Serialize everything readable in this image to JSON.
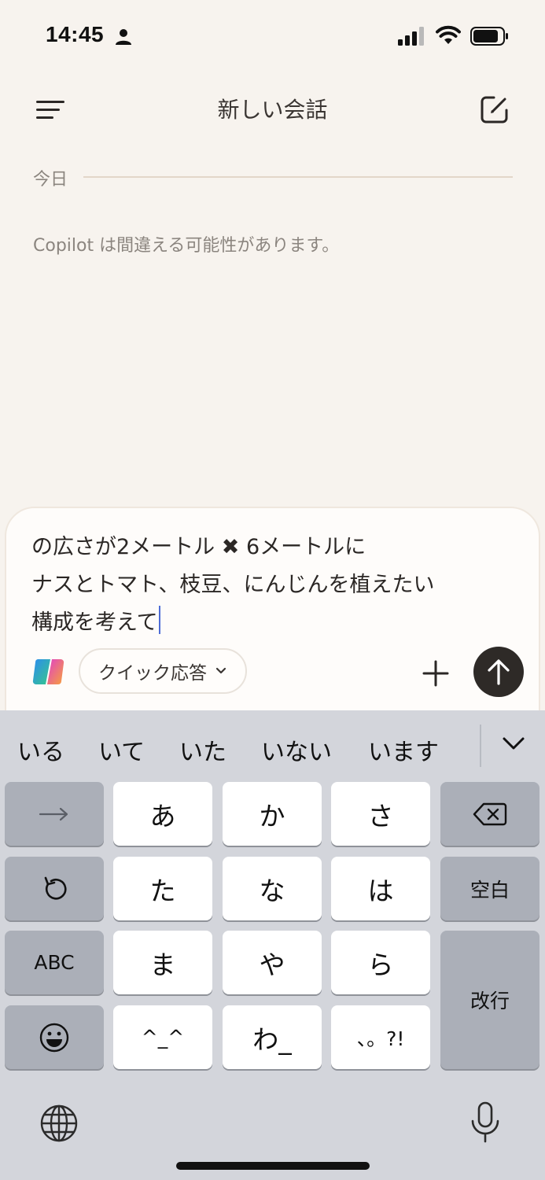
{
  "status_bar": {
    "time": "14:45"
  },
  "header": {
    "title": "新しい会話"
  },
  "date_divider": {
    "label": "今日"
  },
  "disclaimer": "Copilot は間違える可能性があります。",
  "composer": {
    "lines": [
      "の広さが2メートル ✖︎ 6メートルに",
      "ナスとトマト、枝豆、にんじんを植えたい",
      "構成を考えて"
    ],
    "mode_label": "クイック応答"
  },
  "keyboard": {
    "suggestions": [
      "いる",
      "いて",
      "いた",
      "いない",
      "います"
    ],
    "rows": [
      [
        "→",
        "あ",
        "か",
        "さ",
        "⌫"
      ],
      [
        "↺",
        "た",
        "な",
        "は",
        "空白"
      ],
      [
        "ABC",
        "ま",
        "や",
        "ら",
        "改行"
      ],
      [
        "☺",
        "^_^",
        "わ_",
        "、。?!"
      ]
    ],
    "keys": {
      "arrow": "→",
      "a": "あ",
      "ka": "か",
      "sa": "さ",
      "undo": "↺",
      "ta": "た",
      "na": "な",
      "ha": "は",
      "space": "空白",
      "abc": "ABC",
      "ma": "ま",
      "ya": "や",
      "ra": "ら",
      "return": "改行",
      "emoticon": "^_^",
      "wa": "わ_",
      "punct": "、。?!"
    }
  },
  "colors": {
    "background": "#f7f3ee",
    "send_button": "#2e2a27",
    "keyboard_bg": "#d3d5db",
    "caret": "#4e6dd6"
  }
}
